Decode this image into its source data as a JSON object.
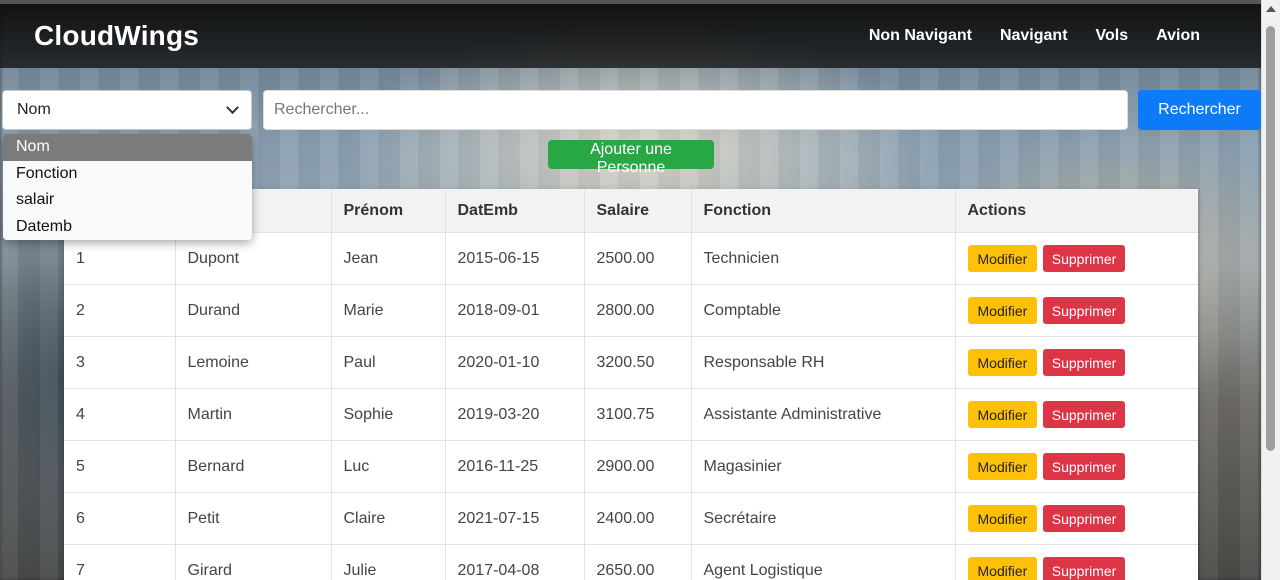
{
  "navbar": {
    "brand": "CloudWings",
    "links": [
      "Non Navigant",
      "Navigant",
      "Vols",
      "Avion"
    ]
  },
  "search": {
    "selected": "Nom",
    "options": [
      "Nom",
      "Fonction",
      "salair",
      "Datemb"
    ],
    "placeholder": "Rechercher...",
    "button_label": "Rechercher"
  },
  "add_button_label": "Ajouter une Personne",
  "table": {
    "headers": [
      "",
      "",
      "Prénom",
      "DatEmb",
      "Salaire",
      "Fonction",
      "Actions"
    ],
    "rows": [
      [
        "1",
        "Dupont",
        "Jean",
        "2015-06-15",
        "2500.00",
        "Technicien"
      ],
      [
        "2",
        "Durand",
        "Marie",
        "2018-09-01",
        "2800.00",
        "Comptable"
      ],
      [
        "3",
        "Lemoine",
        "Paul",
        "2020-01-10",
        "3200.50",
        "Responsable RH"
      ],
      [
        "4",
        "Martin",
        "Sophie",
        "2019-03-20",
        "3100.75",
        "Assistante Administrative"
      ],
      [
        "5",
        "Bernard",
        "Luc",
        "2016-11-25",
        "2900.00",
        "Magasinier"
      ],
      [
        "6",
        "Petit",
        "Claire",
        "2021-07-15",
        "2400.00",
        "Secrétaire"
      ],
      [
        "7",
        "Girard",
        "Julie",
        "2017-04-08",
        "2650.00",
        "Agent Logistique"
      ]
    ],
    "edit_label": "Modifier",
    "delete_label": "Supprimer"
  },
  "colors": {
    "primary": "#0d7bf7",
    "success": "#28a745",
    "warning": "#ffc107",
    "danger": "#dc3545"
  }
}
